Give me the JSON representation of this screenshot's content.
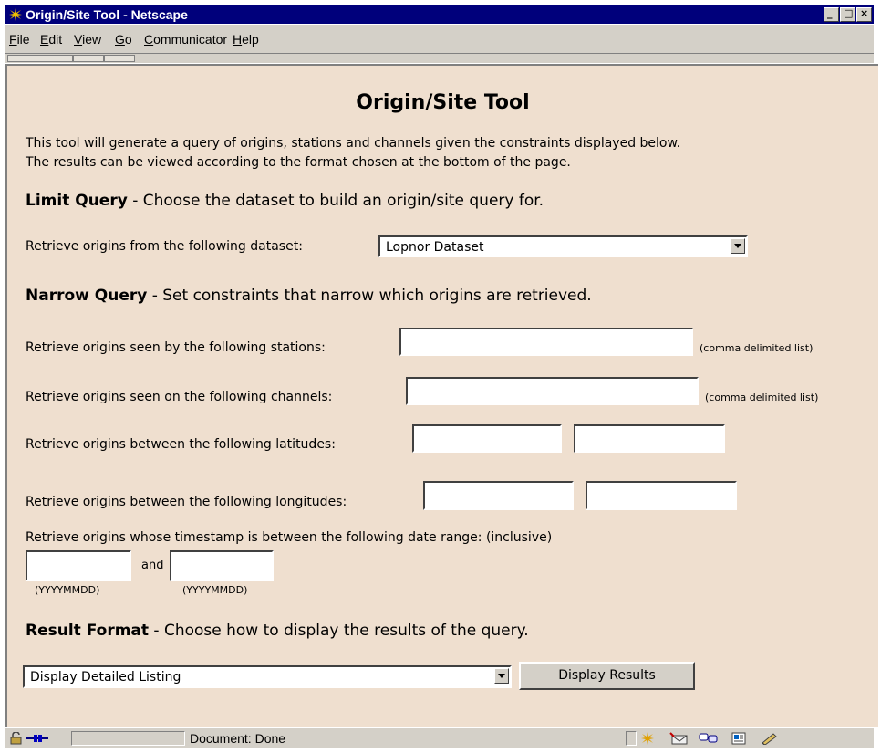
{
  "window": {
    "title": "Origin/Site Tool - Netscape"
  },
  "menu": {
    "items": [
      "File",
      "Edit",
      "View",
      "Go",
      "Communicator",
      "Help"
    ]
  },
  "page": {
    "heading": "Origin/Site Tool",
    "intro_line1": "This tool will generate a query of origins, stations and channels given the constraints displayed below.",
    "intro_line2": "The results can be viewed according to the format chosen at the bottom of the page.",
    "limit": {
      "title": "Limit Query",
      "desc": " - Choose the dataset to build an origin/site query for.",
      "label": "Retrieve origins from the following dataset:",
      "dataset_value": "Lopnor Dataset"
    },
    "narrow": {
      "title": "Narrow Query",
      "desc": " - Set constraints that narrow which origins are retrieved.",
      "stations_label": "Retrieve origins seen by the following stations:",
      "stations_value": "",
      "stations_hint": "(comma delimited list)",
      "channels_label": "Retrieve origins seen on the following channels:",
      "channels_value": "",
      "channels_hint": "(comma delimited list)",
      "latitudes_label": "Retrieve origins between the following latitudes:",
      "lat_min": "",
      "lat_max": "",
      "longitudes_label": "Retrieve origins between the following longitudes:",
      "lon_min": "",
      "lon_max": "",
      "date_label": "Retrieve origins whose timestamp is between the following date range: (inclusive)",
      "date_from": "",
      "date_and": "and",
      "date_to": "",
      "date_hint_from": "(YYYYMMDD)",
      "date_hint_to": "(YYYYMMDD)"
    },
    "result": {
      "title": "Result Format",
      "desc": " - Choose how to display the results of the query.",
      "format_value": "Display Detailed Listing",
      "button_label": "Display Results"
    }
  },
  "status": {
    "text": "Document: Done"
  }
}
